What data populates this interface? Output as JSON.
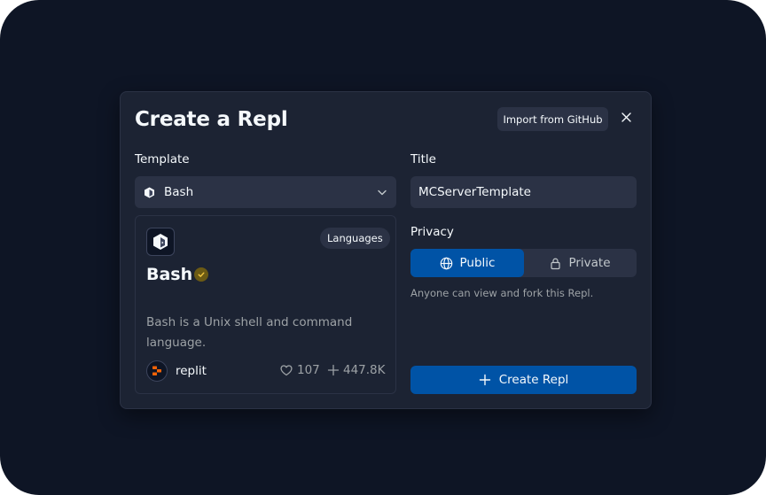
{
  "dialog": {
    "title": "Create a Repl",
    "import_label": "Import from GitHub"
  },
  "template": {
    "label": "Template",
    "selected": "Bash",
    "card": {
      "name": "Bash",
      "tag": "Languages",
      "description": "Bash is a Unix shell and command language.",
      "author": "replit",
      "likes": "107",
      "forks": "447.8K"
    }
  },
  "title_field": {
    "label": "Title",
    "value": "MCServerTemplate"
  },
  "privacy": {
    "label": "Privacy",
    "options": [
      {
        "label": "Public",
        "icon": "globe-icon"
      },
      {
        "label": "Private",
        "icon": "lock-icon"
      }
    ],
    "selected": "Public",
    "hint": "Anyone can view and fork this Repl."
  },
  "create_label": "Create Repl",
  "colors": {
    "background": "#0e1525",
    "surface": "#1c2333",
    "control": "#2b3245",
    "accent": "#0053a6",
    "text": "#f5f9fc",
    "muted": "#9da2a6"
  }
}
